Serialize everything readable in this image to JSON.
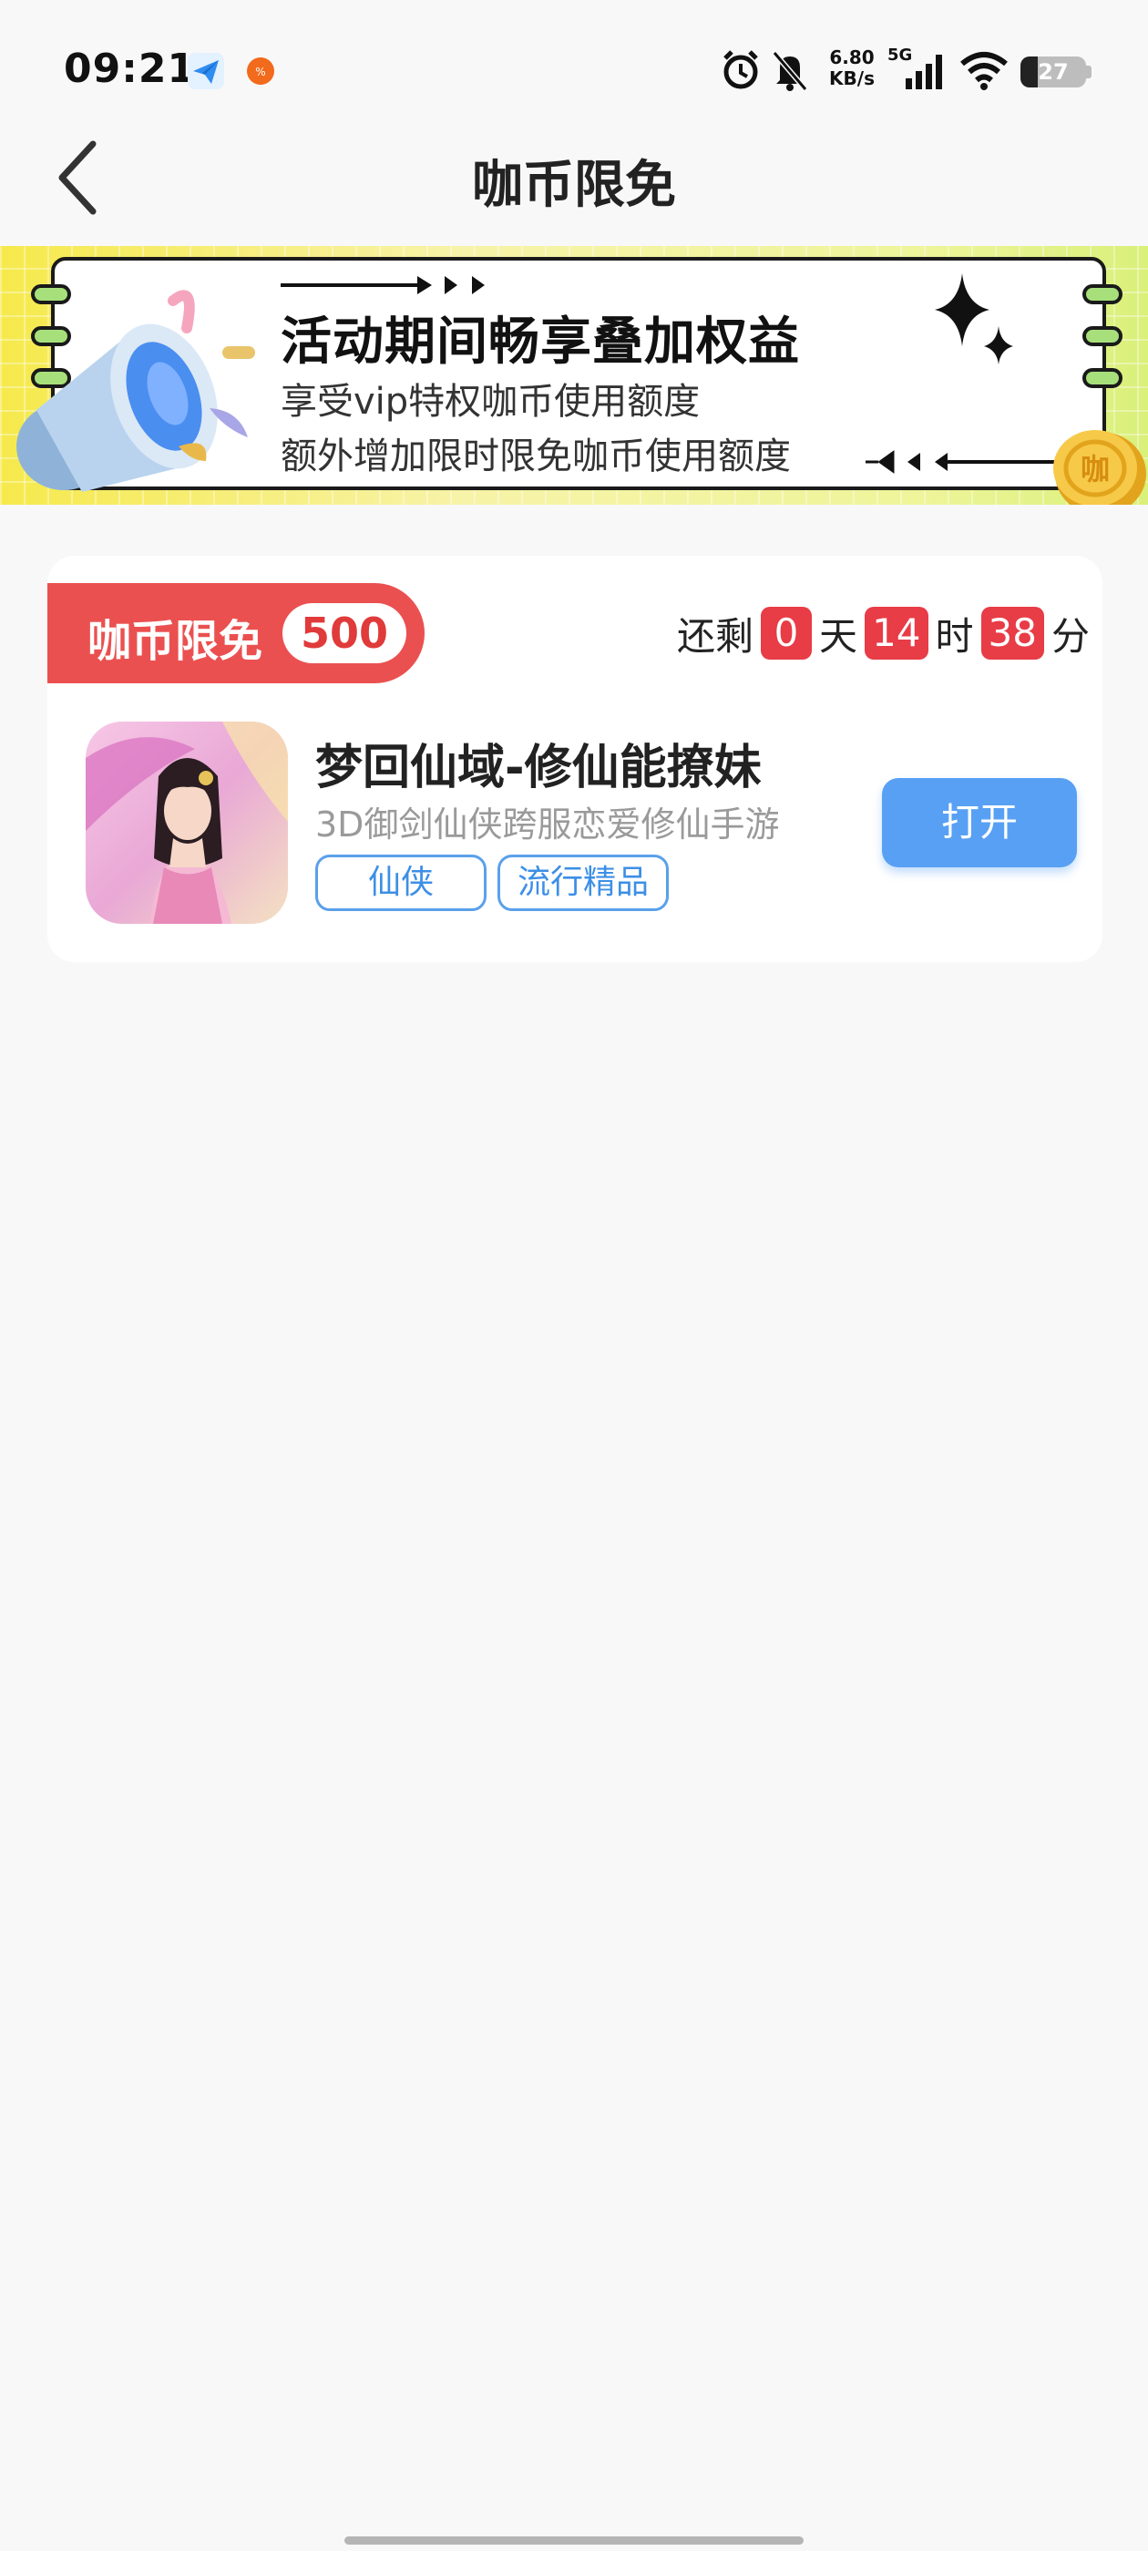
{
  "status_bar": {
    "time": "09:21",
    "net_speed_value": "6.80",
    "net_speed_unit": "KB/s",
    "network": "5G",
    "battery": "27",
    "battery_level": 0.27
  },
  "nav": {
    "title": "咖币限免"
  },
  "banner": {
    "headline": "活动期间畅享叠加权益",
    "line1": "享受vip特权咖币使用额度",
    "line2": "额外增加限时限免咖币使用额度",
    "coin_mark": "咖"
  },
  "promo": {
    "label": "咖币限免",
    "amount": "500"
  },
  "countdown": {
    "prefix": "还剩",
    "days": "0",
    "days_unit": "天",
    "hours": "14",
    "hours_unit": "时",
    "minutes": "38",
    "minutes_unit": "分"
  },
  "game": {
    "title": "梦回仙域-修仙能撩妹",
    "description": "3D御剑仙侠跨服恋爱修仙手游",
    "tags": [
      "仙侠",
      "流行精品"
    ],
    "open_label": "打开"
  },
  "colors": {
    "accent_red": "#eb5050",
    "countdown_red": "#e83c46",
    "button_blue": "#58a0f4",
    "tag_blue": "#3d8fe6"
  }
}
